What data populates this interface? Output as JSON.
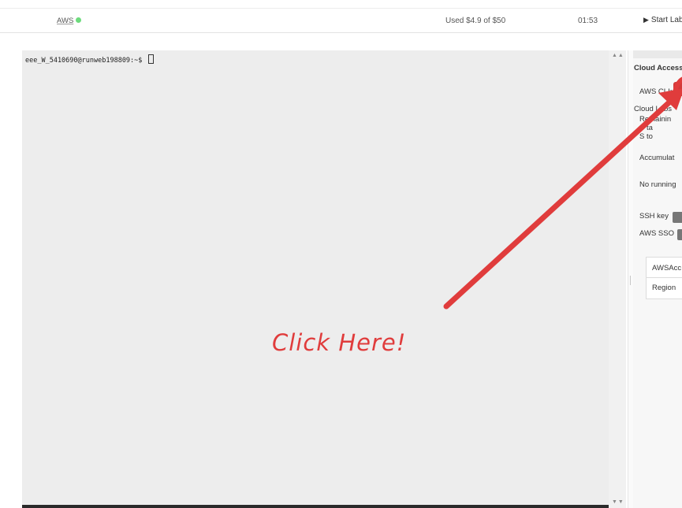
{
  "topbar": {
    "service_label": "AWS",
    "status_color": "#6ddb7d",
    "budget": "Used $4.9 of $50",
    "timer": "01:53",
    "start_lab_icon": "play-icon",
    "start_lab_label": "Start Lab"
  },
  "terminal": {
    "prompt": "eee_W_5410690@runweb198809:~$ "
  },
  "panel": {
    "cloud_access": "Cloud Access",
    "aws_cli_label": "AWS CLI:",
    "cloud_labs": "Cloud Labs",
    "remaining_line": "Remainin",
    "line_two": "S      ta",
    "line_three": "S        to",
    "accumulated": "Accumulat",
    "no_running": "No running",
    "ssh_key": "SSH key",
    "aws_sso": "AWS SSO",
    "table_rows": [
      "AWSAcc",
      "Region"
    ]
  },
  "annotation": {
    "text": "Click Here!",
    "color": "#e03c3c"
  }
}
